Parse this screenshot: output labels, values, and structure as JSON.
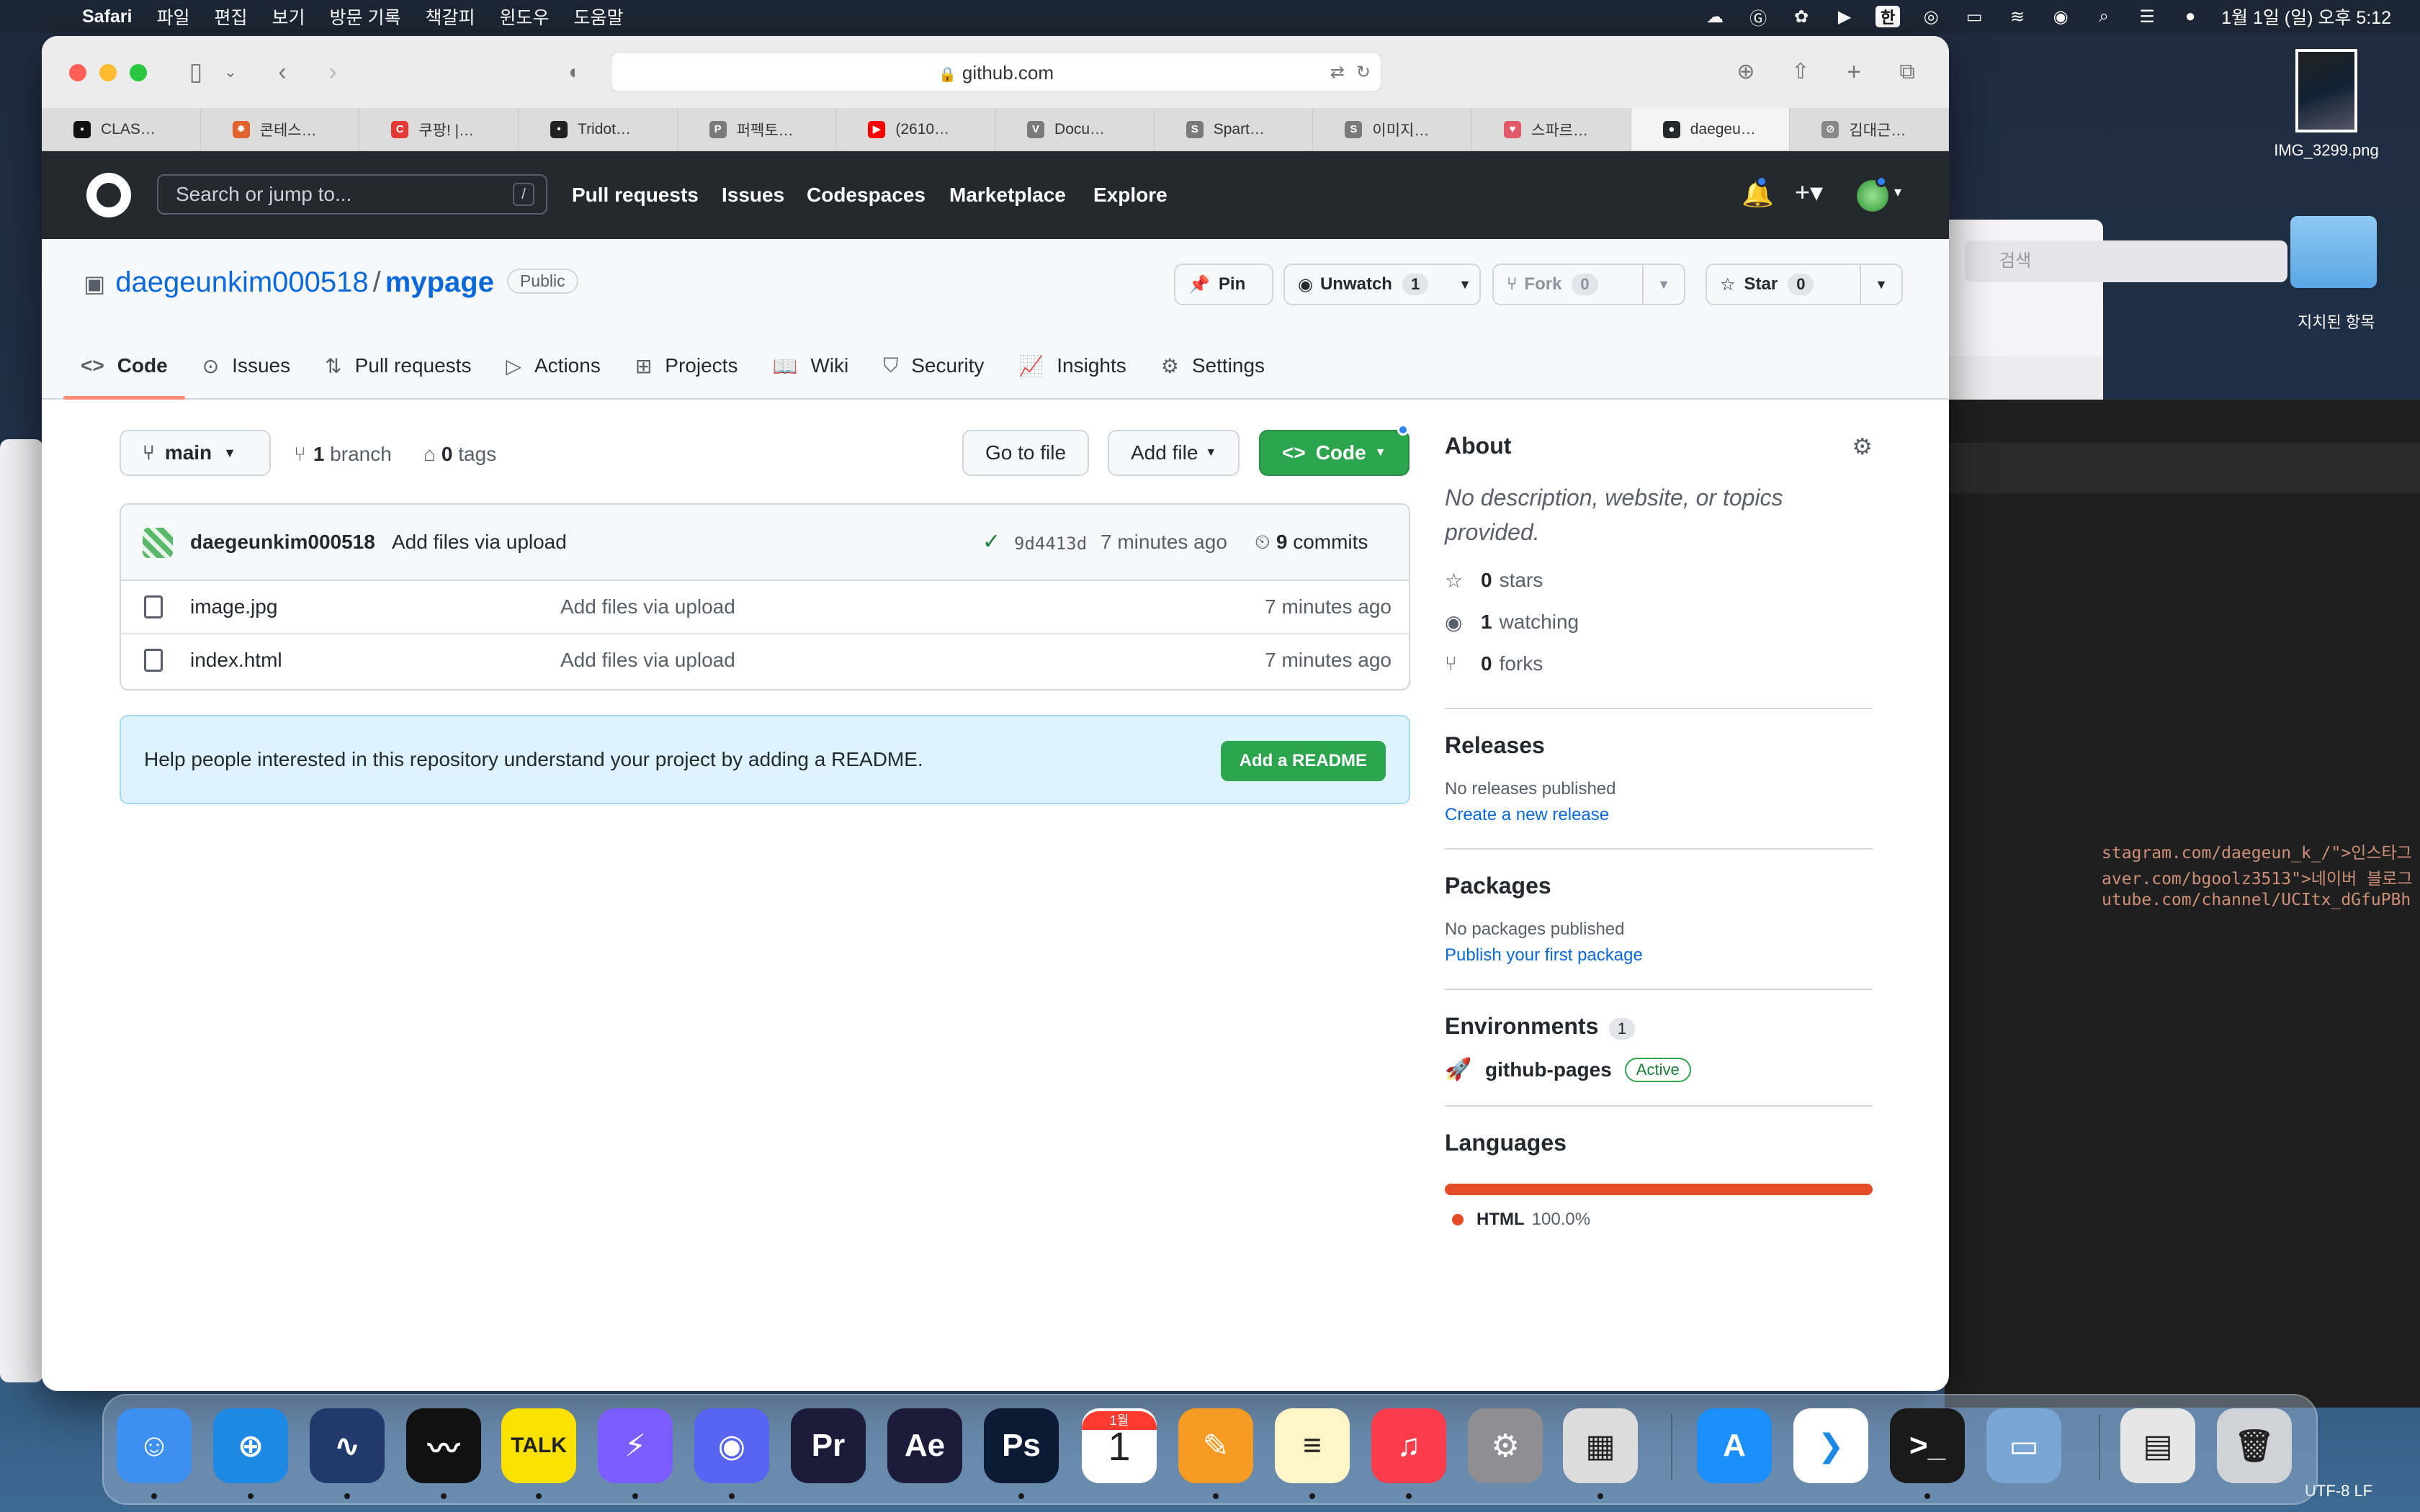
{
  "menubar": {
    "app": "Safari",
    "items": [
      "파일",
      "편집",
      "보기",
      "방문 기록",
      "책갈피",
      "윈도우",
      "도움말"
    ],
    "input_source": "한",
    "datetime": "1월 1일 (일) 오후 5:12"
  },
  "desktop": {
    "file_label": "IMG_3299.png",
    "folder_label": "지치된 항목",
    "search_placeholder": "검색",
    "editor_lines": [
      "stagram.com/daegeun_k_/\">인스타그",
      "aver.com/bgoolz3513\">네이버 블로그",
      "utube.com/channel/UCItx_dGfuPBh"
    ],
    "status_right": "UTF-8   LF"
  },
  "safari": {
    "url": "github.com",
    "tabs": [
      {
        "label": "CLAS…",
        "color": "#111111",
        "glyph": "▪"
      },
      {
        "label": "콘테스…",
        "color": "#e0622d",
        "glyph": "✸"
      },
      {
        "label": "쿠팡! |…",
        "color": "#e53935",
        "glyph": "C"
      },
      {
        "label": "Tridot…",
        "color": "#222222",
        "glyph": "•"
      },
      {
        "label": "퍼펙토…",
        "color": "#7a7a7a",
        "glyph": "P"
      },
      {
        "label": "(2610…",
        "color": "#ff0000",
        "glyph": "▶"
      },
      {
        "label": "Docu…",
        "color": "#7a7a7a",
        "glyph": "V"
      },
      {
        "label": "Spart…",
        "color": "#7a7a7a",
        "glyph": "S"
      },
      {
        "label": "이미지…",
        "color": "#7a7a7a",
        "glyph": "S"
      },
      {
        "label": "스파르…",
        "color": "#e05a6a",
        "glyph": "♥"
      },
      {
        "label": "daegeu…",
        "color": "#24292f",
        "glyph": "●",
        "active": true
      },
      {
        "label": "김대근…",
        "color": "#888888",
        "glyph": "⊘"
      }
    ]
  },
  "github": {
    "search_placeholder": "Search or jump to...",
    "search_shortcut": "/",
    "nav": [
      "Pull requests",
      "Issues",
      "Codespaces",
      "Marketplace",
      "Explore"
    ],
    "repo": {
      "owner": "daegeunkim000518",
      "name": "mypage",
      "visibility": "Public",
      "pin_label": "Pin",
      "unwatch_label": "Unwatch",
      "watch_count": "1",
      "fork_label": "Fork",
      "fork_count": "0",
      "star_label": "Star",
      "star_count": "0"
    },
    "repo_tabs": [
      "Code",
      "Issues",
      "Pull requests",
      "Actions",
      "Projects",
      "Wiki",
      "Security",
      "Insights",
      "Settings"
    ],
    "branch": "main",
    "branches_count": "1",
    "branches_label": "branch",
    "tags_count": "0",
    "tags_label": "tags",
    "go_to_file": "Go to file",
    "add_file": "Add file",
    "code_button": "Code",
    "latest_commit": {
      "author": "daegeunkim000518",
      "message": "Add files via upload",
      "sha": "9d4413d",
      "time": "7 minutes ago",
      "commits_count": "9",
      "commits_label": "commits"
    },
    "files": [
      {
        "name": "image.jpg",
        "message": "Add files via upload",
        "time": "7 minutes ago"
      },
      {
        "name": "index.html",
        "message": "Add files via upload",
        "time": "7 minutes ago"
      }
    ],
    "readme_prompt": "Help people interested in this repository understand your project by adding a README.",
    "readme_button": "Add a README",
    "about": {
      "title": "About",
      "description": "No description, website, or topics provided.",
      "stars_count": "0",
      "stars_label": "stars",
      "watching_count": "1",
      "watching_label": "watching",
      "forks_count": "0",
      "forks_label": "forks"
    },
    "releases": {
      "title": "Releases",
      "empty": "No releases published",
      "link": "Create a new release"
    },
    "packages": {
      "title": "Packages",
      "empty": "No packages published",
      "link": "Publish your first package"
    },
    "environments": {
      "title": "Environments",
      "count": "1",
      "name": "github-pages",
      "status": "Active"
    },
    "languages": {
      "title": "Languages",
      "name": "HTML",
      "percent": "100.0%",
      "fraction": 1.0,
      "color": "#e34c26"
    }
  },
  "dock": {
    "apps": [
      {
        "name": "finder",
        "bg": "#3d8ff0",
        "glyph": "☺"
      },
      {
        "name": "safari",
        "bg": "#1e88e5",
        "glyph": "⊕"
      },
      {
        "name": "whale",
        "bg": "#223a6b",
        "glyph": "∿"
      },
      {
        "name": "stocks",
        "bg": "#111111",
        "glyph": "〰"
      },
      {
        "name": "kakaotalk",
        "bg": "#fae100",
        "glyph": "TALK"
      },
      {
        "name": "messenger",
        "bg": "#7b5cff",
        "glyph": "⚡"
      },
      {
        "name": "discord",
        "bg": "#5865f2",
        "glyph": "◉"
      },
      {
        "name": "premiere",
        "bg": "#1c1c3a",
        "glyph": "Pr"
      },
      {
        "name": "after-effects",
        "bg": "#1c1c3a",
        "glyph": "Ae"
      },
      {
        "name": "photoshop",
        "bg": "#0c1b33",
        "glyph": "Ps"
      },
      {
        "name": "calendar",
        "bg": "#ffffff",
        "glyph": "1"
      },
      {
        "name": "pages",
        "bg": "#f59b23",
        "glyph": "✎"
      },
      {
        "name": "notes",
        "bg": "#fff6c8",
        "glyph": "≡"
      },
      {
        "name": "music",
        "bg": "#fa3c4c",
        "glyph": "♫"
      },
      {
        "name": "system-settings",
        "bg": "#8e8e93",
        "glyph": "⚙"
      },
      {
        "name": "launchpad",
        "bg": "#dcdcdc",
        "glyph": "▦"
      },
      {
        "name": "app-store",
        "bg": "#1c8ef9",
        "glyph": "A"
      },
      {
        "name": "vscode",
        "bg": "#ffffff",
        "glyph": "❯"
      },
      {
        "name": "terminal",
        "bg": "#1a1a1a",
        "glyph": ">_"
      },
      {
        "name": "preview",
        "bg": "#7aa6d6",
        "glyph": "▭"
      },
      {
        "name": "downloads-stack",
        "bg": "#e6e6e6",
        "glyph": "▤"
      },
      {
        "name": "trash",
        "bg": "#cfd3d8",
        "glyph": "🗑"
      }
    ],
    "calendar_month": "1월"
  }
}
